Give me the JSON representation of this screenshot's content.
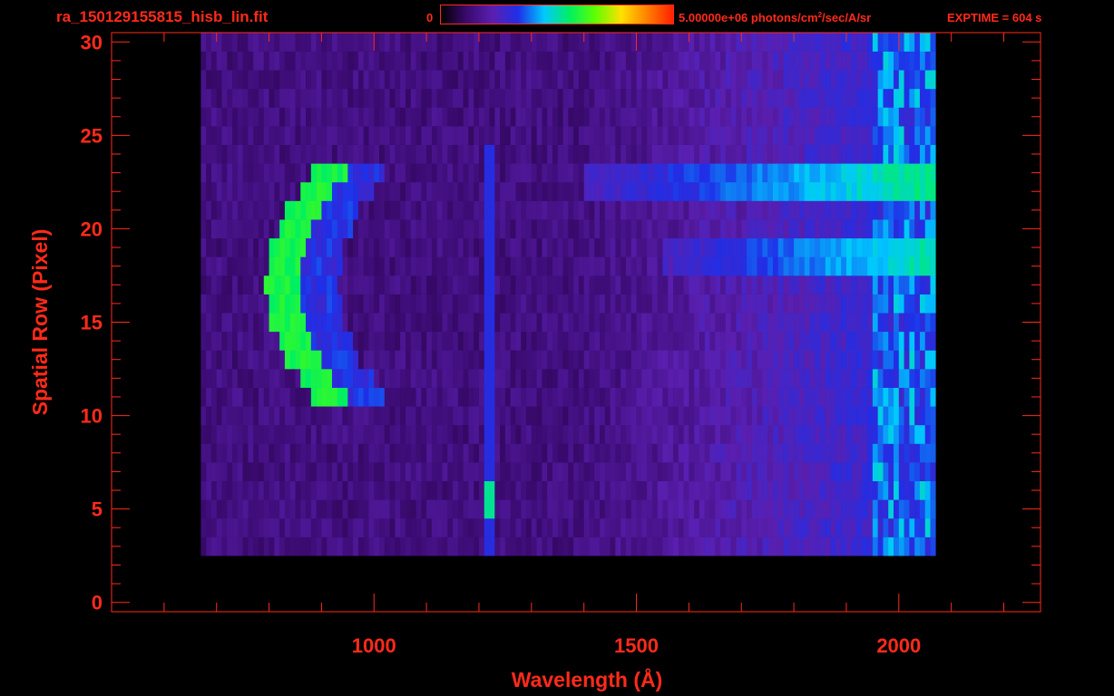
{
  "header": {
    "file_title": "ra_150129155815_hisb_lin.fit",
    "colorbar_min": "0",
    "colorbar_max_prefix": "5.00000e+06 photons/cm",
    "colorbar_max_sup": "2",
    "colorbar_max_suffix": "/sec/A/sr",
    "exptime": "EXPTIME = 604 s"
  },
  "colors": {
    "axis": "#ff2a1a",
    "background": "#000000",
    "colormap": [
      "#000000",
      "#3a0a6e",
      "#5a1fb0",
      "#1f2fe8",
      "#00c8ff",
      "#00f060",
      "#60ff00",
      "#ffe000",
      "#ff8000",
      "#ff2000"
    ]
  },
  "chart_data": {
    "type": "heatmap",
    "title": "ra_150129155815_hisb_lin.fit",
    "xlabel": "Wavelength (Å)",
    "ylabel": "Spatial Row (Pixel)",
    "xlim": [
      500,
      2270
    ],
    "ylim": [
      -0.5,
      30.5
    ],
    "x_ticks": [
      1000,
      1500,
      2000
    ],
    "y_ticks": [
      0,
      5,
      10,
      15,
      20,
      25,
      30
    ],
    "colorbar": {
      "min": 0,
      "max": 5000000,
      "units": "photons/cm^2/sec/A/sr"
    },
    "detector_extent": {
      "x_range": [
        670,
        2070
      ],
      "row_range": [
        3,
        30
      ]
    },
    "features": [
      {
        "name": "bright arc",
        "wavelength_range": [
          800,
          960
        ],
        "rows": [
          11,
          23
        ],
        "peak_level": 0.55
      },
      {
        "name": "narrow line",
        "wavelength": 1216,
        "rows": [
          3,
          24
        ],
        "peak_level": 0.4,
        "peak_rows": [
          5,
          6
        ]
      },
      {
        "name": "band upper",
        "wavelength_range": [
          1400,
          2060
        ],
        "rows": [
          22,
          23
        ],
        "peak_level": 0.45
      },
      {
        "name": "band lower",
        "wavelength_range": [
          1550,
          2060
        ],
        "rows": [
          18,
          19
        ],
        "peak_level": 0.42
      },
      {
        "name": "red edge",
        "wavelength_range": [
          1950,
          2070
        ],
        "rows": [
          3,
          30
        ],
        "peak_level": 0.4
      }
    ]
  }
}
